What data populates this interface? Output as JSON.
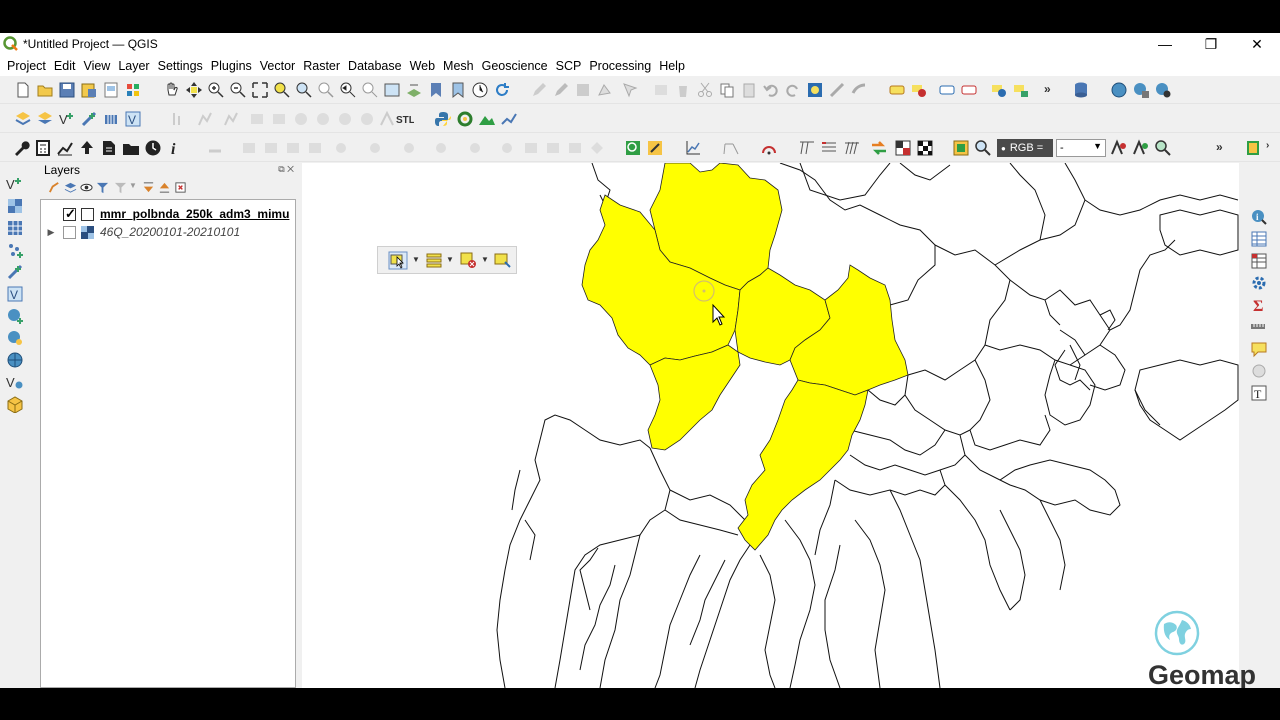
{
  "window": {
    "title": "*Untitled Project — QGIS",
    "controls": [
      "—",
      "❐",
      "✕"
    ]
  },
  "menu": [
    "Project",
    "Edit",
    "View",
    "Layer",
    "Settings",
    "Plugins",
    "Vector",
    "Raster",
    "Database",
    "Web",
    "Mesh",
    "Geoscience",
    "SCP",
    "Processing",
    "Help"
  ],
  "toolbar3": {
    "rgb_label": "RGB =",
    "rgb_value": "-"
  },
  "layers_panel": {
    "title": "Layers",
    "layers": [
      {
        "name": "mmr_polbnda_250k_adm3_mimu",
        "checked": true,
        "type": "vector"
      },
      {
        "name": "46Q_20200101-20210101",
        "checked": false,
        "type": "raster"
      }
    ]
  },
  "watermark": {
    "brand": "Geomap"
  },
  "colors": {
    "selection_fill": "#ffff00",
    "accent": "#589632"
  }
}
